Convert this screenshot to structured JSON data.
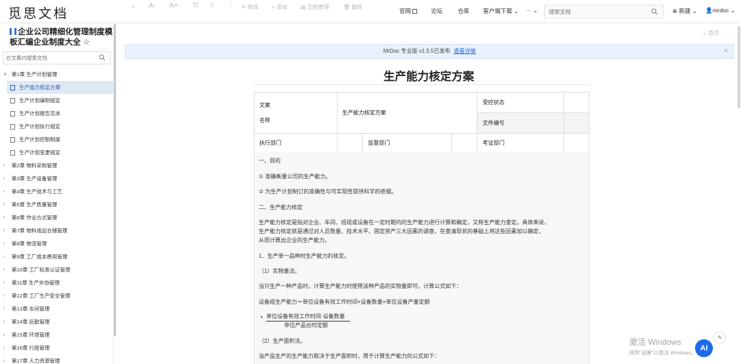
{
  "app": {
    "logo": "觅思文档"
  },
  "nav": {
    "official": "官网",
    "forum": "论坛",
    "repo": "仓库",
    "client_download": "客户端下载",
    "more": "···",
    "search_placeholder": "搜索文档",
    "new_label": "新建",
    "user": "mrdoc"
  },
  "sidebar": {
    "title": "企业公司精细化管理制度模板汇编企业制度大全 ☆",
    "search_placeholder": "在文集内搜索文档",
    "items": [
      {
        "label": "第1章 生产计划管理",
        "type": "chapter",
        "expanded": true
      },
      {
        "label": "生产能力核定方案",
        "type": "doc",
        "active": true
      },
      {
        "label": "生产计划编制规定",
        "type": "doc"
      },
      {
        "label": "生产计划报告范本",
        "type": "doc"
      },
      {
        "label": "生产计划执行规定",
        "type": "doc"
      },
      {
        "label": "生产计划控制制度",
        "type": "doc"
      },
      {
        "label": "生产计划变更规定",
        "type": "doc"
      },
      {
        "label": "第2章 物料采购管理",
        "type": "chapter"
      },
      {
        "label": "第3章 生产设备管理",
        "type": "chapter"
      },
      {
        "label": "第4章 生产技术与工艺",
        "type": "chapter"
      },
      {
        "label": "第5章 生产质量管理",
        "type": "chapter"
      },
      {
        "label": "第6章 作业方式管理",
        "type": "chapter"
      },
      {
        "label": "第7章 物料成品仓储管理",
        "type": "chapter"
      },
      {
        "label": "第8章 物流管理",
        "type": "chapter"
      },
      {
        "label": "第9章 工厂成本费用管理",
        "type": "chapter"
      },
      {
        "label": "第10章 工厂标准认证管理",
        "type": "chapter"
      },
      {
        "label": "第11章 生产外协管理",
        "type": "chapter"
      },
      {
        "label": "第12章 工厂生产安全管理",
        "type": "chapter"
      },
      {
        "label": "第13章 车间管理",
        "type": "chapter"
      },
      {
        "label": "第14章 后勤管理",
        "type": "chapter"
      },
      {
        "label": "第15章 环境管理",
        "type": "chapter"
      },
      {
        "label": "第16章 行政管理",
        "type": "chapter"
      },
      {
        "label": "第17章 人力资源管理",
        "type": "chapter"
      }
    ]
  },
  "toolbar": {
    "menu": "≡",
    "font_smaller": "A-",
    "font_larger": "A+",
    "font_style": "Tl",
    "night": "☾",
    "more": "⋮",
    "edit": "修改",
    "add": "添加",
    "manage": "文档管理",
    "delete": "删除",
    "home": "首页"
  },
  "banner": {
    "text": "MrDoc 专业版 v1.5.5已发布",
    "link": "查看详情",
    "close": "×"
  },
  "doc": {
    "title": "生产能力核定方案",
    "table": {
      "doc_label_1": "文案",
      "doc_label_2": "名称",
      "doc_name": "生产能力核定方案",
      "control_status": "受控状态",
      "doc_number": "文件编号",
      "exec_dept": "执行部门",
      "supervise_dept": "监督部门",
      "review_dept": "考证部门"
    },
    "paragraphs": {
      "p1": "一、目的",
      "p2": "① 准确衡量公司的生产能力。",
      "p3": "② 为生产计划制订的准确性与可实现性提供科学的依据。",
      "p4": "二、生产能力核定",
      "p5a": "生产能力核定是指对企业、车间、班组或设备在一定时期内的生产能力进行计算和确定，又称生产能力查定。具体来说，",
      "p5b": "生产能力核定就是通过对人员数量、技术水平、固定资产三大因素的调查，在查清现状的基础上将这些因素加以确定，",
      "p5c": "从而计算出企业的生产能力。",
      "p6": "1．生产单一品种时生产能力的核定。",
      "p7": "（1）实物量法。",
      "p8": "当只生产一种产品时，计算生产能力时使用该种产品的实物量即可，计算公式如下：",
      "p9": "设备组生产能力＝单位设备有效工作时间×设备数量×单位设备产量定额",
      "frac_num": "单位设备有效工作时间·设备数量",
      "frac_den": "单位产品台时定额",
      "p10": "（2）生产面积法。",
      "p11": "当产品生产的生产能力取决于生产面积时，用于计算生产能力的公式如下："
    }
  },
  "overlay": {
    "watermark_1": "激活 Windows",
    "watermark_2": "转到\"设置\"以激活 Windows。",
    "ai": "AI"
  }
}
